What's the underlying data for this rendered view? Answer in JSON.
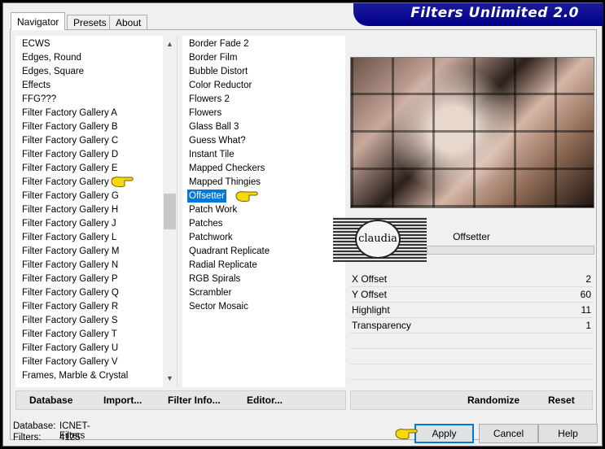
{
  "app": {
    "title": "Filters Unlimited 2.0"
  },
  "tabs": [
    {
      "label": "Navigator"
    },
    {
      "label": "Presets"
    },
    {
      "label": "About"
    }
  ],
  "categories": [
    "ECWS",
    "Edges, Round",
    "Edges, Square",
    "Effects",
    "FFG???",
    "Filter Factory Gallery A",
    "Filter Factory Gallery B",
    "Filter Factory Gallery C",
    "Filter Factory Gallery D",
    "Filter Factory Gallery E",
    "Filter Factory Gallery F",
    "Filter Factory Gallery G",
    "Filter Factory Gallery H",
    "Filter Factory Gallery J",
    "Filter Factory Gallery L",
    "Filter Factory Gallery M",
    "Filter Factory Gallery N",
    "Filter Factory Gallery P",
    "Filter Factory Gallery Q",
    "Filter Factory Gallery R",
    "Filter Factory Gallery S",
    "Filter Factory Gallery T",
    "Filter Factory Gallery U",
    "Filter Factory Gallery V",
    "Frames, Marble & Crystal"
  ],
  "filters": [
    "Border Fade 2",
    "Border Film",
    "Bubble Distort",
    "Color Reductor",
    "Flowers 2",
    "Flowers",
    "Glass Ball 3",
    "Guess What?",
    "Instant Tile",
    "Mapped Checkers",
    "Mapped Thingies",
    "Offsetter",
    "Patch Work",
    "Patches",
    "Patchwork",
    "Quadrant Replicate",
    "Radial Replicate",
    "RGB Spirals",
    "Scrambler",
    "Sector Mosaic"
  ],
  "selected_filter_index": 11,
  "watermark": {
    "text": "claudia"
  },
  "filter_panel": {
    "name": "Offsetter",
    "params": [
      {
        "label": "X Offset",
        "value": "2"
      },
      {
        "label": "Y Offset",
        "value": "60"
      },
      {
        "label": "Highlight",
        "value": "11"
      },
      {
        "label": "Transparency",
        "value": "1"
      }
    ]
  },
  "toolbar": {
    "database": "Database",
    "import": "Import...",
    "filter_info": "Filter Info...",
    "editor": "Editor...",
    "randomize": "Randomize",
    "reset": "Reset"
  },
  "status": {
    "database_label": "Database:",
    "database_value": "ICNET-Filters",
    "filters_label": "Filters:",
    "filters_value": "4125"
  },
  "buttons": {
    "apply": "Apply",
    "cancel": "Cancel",
    "help": "Help"
  },
  "colors": {
    "title_bg": "#000088",
    "selection": "#0078d7",
    "pointer_hand": "#f5d90a"
  }
}
